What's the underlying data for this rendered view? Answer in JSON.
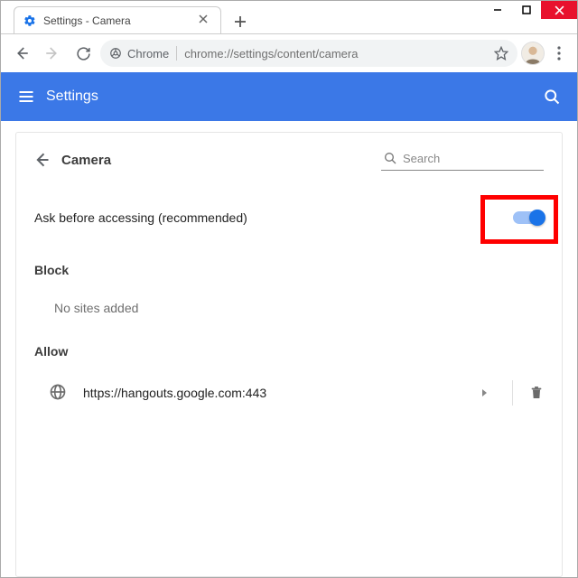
{
  "window": {
    "tab_title": "Settings - Camera"
  },
  "omnibox": {
    "chip_label": "Chrome",
    "url": "chrome://settings/content/camera"
  },
  "header": {
    "title": "Settings"
  },
  "page": {
    "title": "Camera",
    "search_placeholder": "Search"
  },
  "setting": {
    "label": "Ask before accessing (recommended)",
    "enabled": true
  },
  "sections": {
    "block_label": "Block",
    "block_empty": "No sites added",
    "allow_label": "Allow",
    "allow_items": [
      {
        "url": "https://hangouts.google.com:443"
      }
    ]
  }
}
